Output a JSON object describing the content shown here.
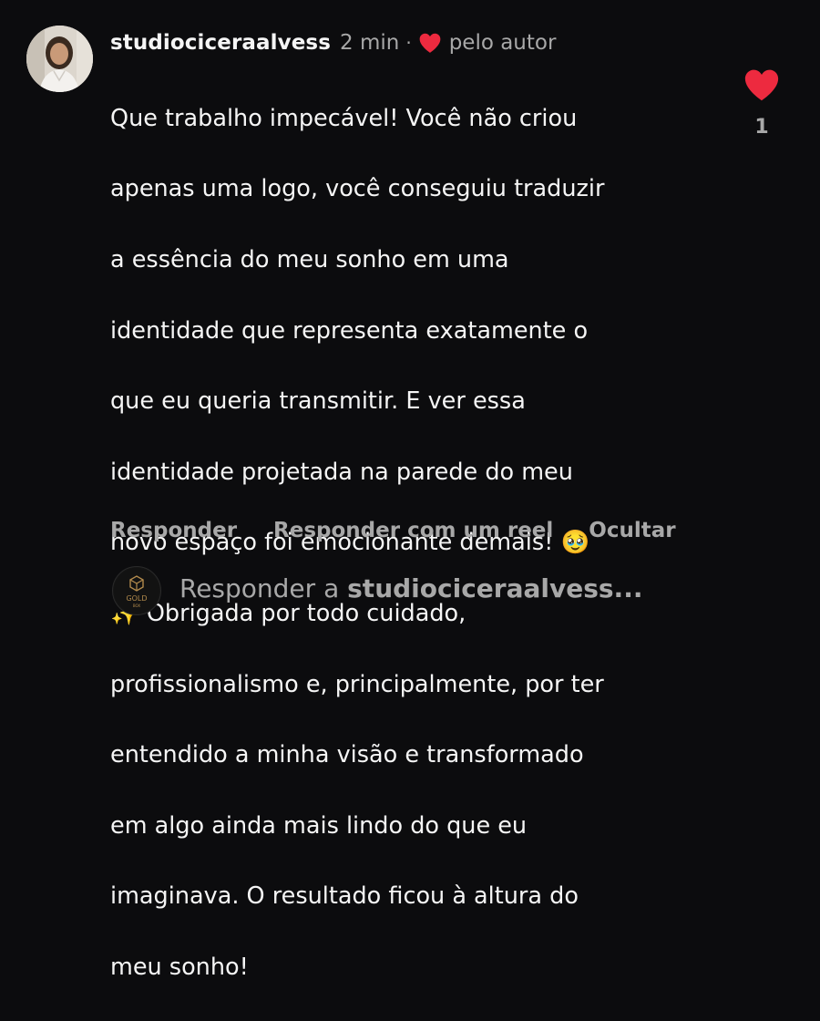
{
  "comment": {
    "username": "studiociceraalvess",
    "time": "2 min",
    "separator": "·",
    "author_liked_label": "pelo autor",
    "author_liked_icon": "heart-icon",
    "text_lines": [
      "Que trabalho impecável! Você não criou",
      "apenas uma logo, você conseguiu traduzir",
      "a essência do meu sonho em uma",
      "identidade que representa exatamente o",
      "que eu queria transmitir. E ver essa",
      "identidade projetada na parede do meu",
      "novo espaço foi emocionante demais! 🥹",
      "✨ Obrigada por todo cuidado,",
      "profissionalismo e, principalmente, por ter",
      "entendido a minha visão e transformado",
      "em algo ainda mais lindo do que eu",
      "imaginava. O resultado ficou à altura do",
      "meu sonho!"
    ],
    "like_icon": "heart-filled-icon",
    "like_count": "1",
    "like_color": "#ed2a3f"
  },
  "actions": {
    "reply": "Responder",
    "reply_reel": "Responder com um reel",
    "hide": "Ocultar"
  },
  "reply_bar": {
    "prefix": "Responder a ",
    "target": "studiociceraalvess...",
    "avatar_text_top": "GOLD",
    "avatar_text_bottom": "BOX"
  },
  "colors": {
    "background": "#0c0c0e",
    "primary_text": "#f5f5f5",
    "secondary_text": "#a8a8a8",
    "heart": "#ed2a3f",
    "gold": "#b38b4d"
  }
}
